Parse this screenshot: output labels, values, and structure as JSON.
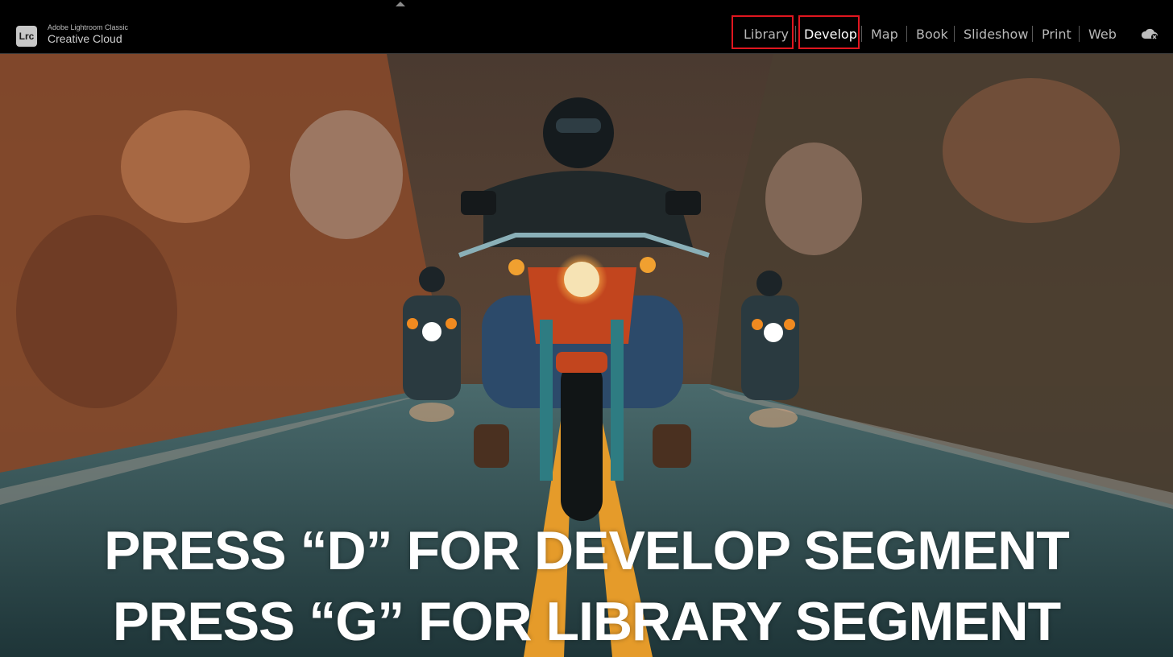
{
  "app": {
    "badge": "Lrc",
    "name_small": "Adobe Lightroom Classic",
    "name_large": "Creative Cloud"
  },
  "nav": {
    "items": [
      {
        "label": "Library",
        "highlighted": true
      },
      {
        "label": "Develop",
        "highlighted": true,
        "active": true
      },
      {
        "label": "Map"
      },
      {
        "label": "Book"
      },
      {
        "label": "Slideshow"
      },
      {
        "label": "Print"
      },
      {
        "label": "Web"
      }
    ],
    "cloud_icon": "cloud-sync-icon"
  },
  "overlay": {
    "line1": "PRESS “D” FOR DEVELOP SEGMENT",
    "line2": "PRESS “G” FOR LIBRARY SEGMENT"
  },
  "colors": {
    "highlight_box": "#e0161f",
    "caption_text": "#ffffff",
    "topbar_bg": "#000000"
  }
}
